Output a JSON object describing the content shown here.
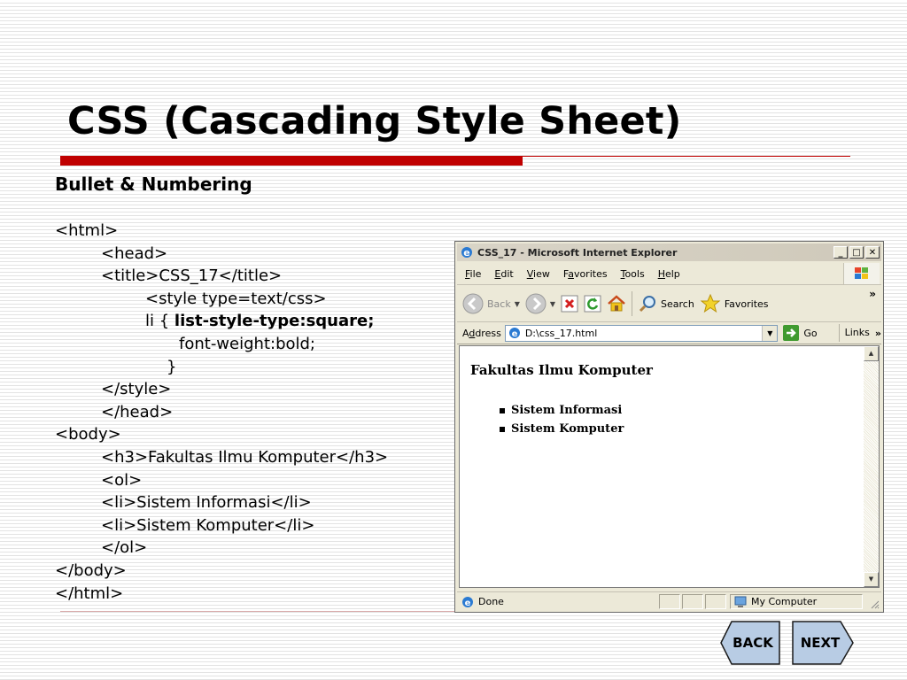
{
  "slide": {
    "title": "CSS (Cascading Style Sheet)",
    "subtitle": "Bullet & Numbering",
    "code_lines": [
      {
        "indent": 0,
        "text": "<html>"
      },
      {
        "indent": 1,
        "text": "<head>"
      },
      {
        "indent": 1,
        "text": "<title>CSS_17</title>"
      },
      {
        "indent": 2,
        "text": "<style type=text/css>"
      },
      {
        "indent": 2,
        "text": "li { ",
        "bold": "list-style-type:square;"
      },
      {
        "indent": 3,
        "text": "font-weight:bold;"
      },
      {
        "indent": 3,
        "text": "}"
      },
      {
        "indent": 1,
        "text": "</style>"
      },
      {
        "indent": 1,
        "text": "</head>"
      },
      {
        "indent": 0,
        "text": "<body>"
      },
      {
        "indent": 1,
        "text": "<h3>Fakultas Ilmu Komputer</h3>"
      },
      {
        "indent": 1,
        "text": "<ol>"
      },
      {
        "indent": 1,
        "text": "<li>Sistem Informasi</li>"
      },
      {
        "indent": 1,
        "text": "<li>Sistem Komputer</li>"
      },
      {
        "indent": 1,
        "text": "</ol>"
      },
      {
        "indent": 0,
        "text": "</body>"
      },
      {
        "indent": 0,
        "text": "</html>"
      }
    ]
  },
  "browser": {
    "window_title": "CSS_17 - Microsoft Internet Explorer",
    "menu": [
      {
        "key": "F",
        "rest": "ile"
      },
      {
        "key": "E",
        "rest": "dit"
      },
      {
        "key": "V",
        "rest": "iew"
      },
      {
        "pre": "F",
        "key": "a",
        "rest": "vorites"
      },
      {
        "key": "T",
        "rest": "ools"
      },
      {
        "key": "H",
        "rest": "elp"
      }
    ],
    "toolbar": {
      "back": "Back",
      "search": "Search",
      "favorites": "Favorites",
      "more": "»"
    },
    "address": {
      "label_pre": "A",
      "label_key": "d",
      "label_rest": "dress",
      "value": "D:\\css_17.html",
      "go": "Go",
      "links": "Links",
      "links_more": "»"
    },
    "page": {
      "heading": "Fakultas Ilmu Komputer",
      "items": [
        "Sistem Informasi",
        "Sistem Komputer"
      ]
    },
    "status": {
      "text": "Done",
      "zone": "My Computer"
    }
  },
  "nav": {
    "back": "BACK",
    "next": "NEXT"
  },
  "colors": {
    "accent_red": "#c00000",
    "nav_fill": "#b8cce4"
  }
}
